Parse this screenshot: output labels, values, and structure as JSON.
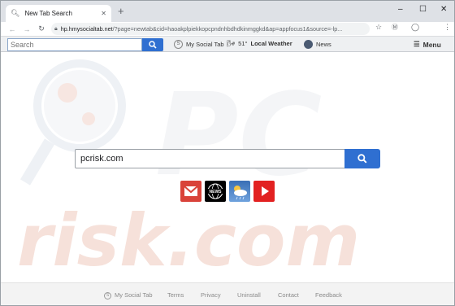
{
  "browser": {
    "tab_title": "New Tab Search",
    "new_tab_symbol": "+",
    "window_controls": {
      "minimize": "–",
      "maximize": "☐",
      "close": "✕"
    },
    "url_host": "hp.hmysocialtab.net",
    "url_path": "/?page=newtab&cid=haoakplpiekkopcpndnhbdhdkinmggkd&ap=appfocus1&source=-lp...",
    "tab_close": "✕"
  },
  "toolbar": {
    "search_placeholder": "Search",
    "my_social_tab": "My Social Tab",
    "weather_temp": "51°",
    "weather_label": "Local Weather",
    "news": "News",
    "menu": "Menu"
  },
  "main": {
    "search_value": "pcrisk.com"
  },
  "quick_links": [
    {
      "name": "Gmail"
    },
    {
      "name": "News",
      "label": "NEWS"
    },
    {
      "name": "Weather"
    },
    {
      "name": "YouTube"
    }
  ],
  "footer": {
    "links": [
      "My Social Tab",
      "Terms",
      "Privacy",
      "Uninstall",
      "Contact",
      "Feedback"
    ]
  },
  "colors": {
    "accent": "#2f6fd1",
    "watermark": "#f3d6cd"
  }
}
